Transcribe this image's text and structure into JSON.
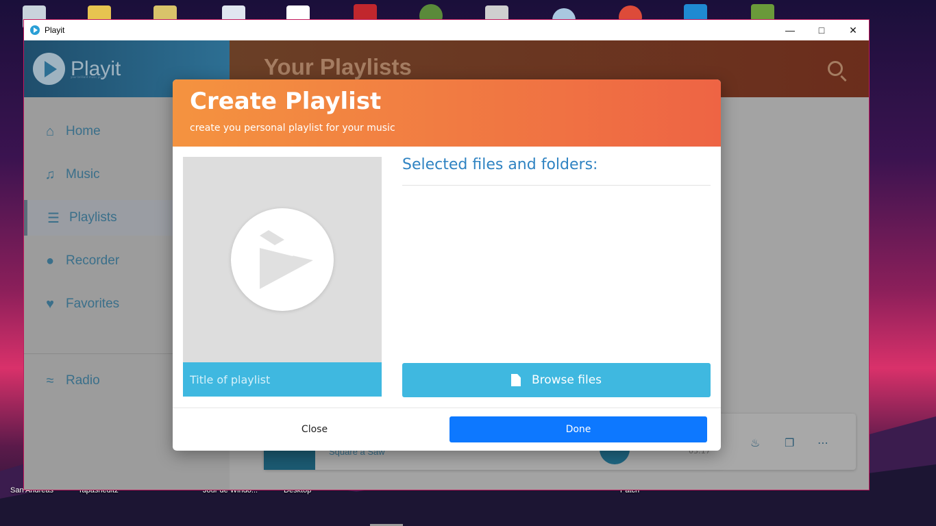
{
  "window": {
    "title": "Playit"
  },
  "sidebar": {
    "brand": "Playit",
    "tagline": "your brilliant music player",
    "items": [
      {
        "label": "Home",
        "icon": "home-icon"
      },
      {
        "label": "Music",
        "icon": "music-note-icon"
      },
      {
        "label": "Playlists",
        "icon": "list-icon",
        "active": true
      },
      {
        "label": "Recorder",
        "icon": "microphone-icon"
      },
      {
        "label": "Favorites",
        "icon": "heart-icon"
      },
      {
        "label": "Radio",
        "icon": "wifi-icon"
      }
    ]
  },
  "header": {
    "title": "Your Playlists"
  },
  "player": {
    "track": "Square a Saw",
    "time": "03:17"
  },
  "dialog": {
    "title": "Create Playlist",
    "subtitle": "create you personal playlist for your music",
    "title_placeholder": "Title of playlist",
    "selected_heading": "Selected files and folders:",
    "browse_label": "Browse files",
    "close_label": "Close",
    "done_label": "Done"
  },
  "desktop": {
    "labels": [
      "San Andreas",
      "Tapasheditz",
      "Jour de Windo...",
      "Desktop",
      "Patch"
    ]
  },
  "colors": {
    "accent_blue": "#3fb8e0",
    "done_blue": "#0d78ff",
    "header_orange": "#f49340",
    "header_red": "#ee6444"
  }
}
